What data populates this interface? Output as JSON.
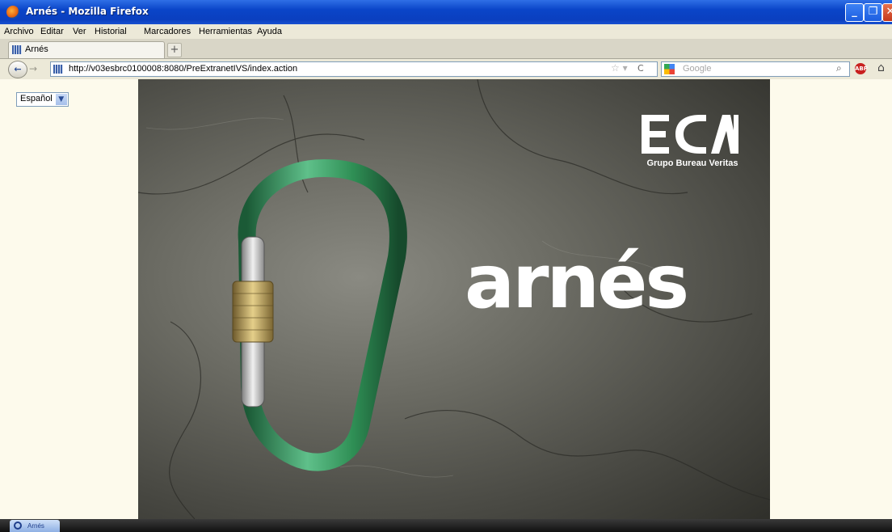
{
  "window": {
    "title": "Arnés - Mozilla Firefox",
    "controls": [
      "minimize",
      "maximize",
      "close"
    ]
  },
  "menu": {
    "items": [
      "Archivo",
      "Editar",
      "Ver",
      "Historial",
      "Marcadores",
      "Herramientas",
      "Ayuda"
    ]
  },
  "tabs": {
    "active_label": "Arnés",
    "new_tab_label": "+"
  },
  "navbar": {
    "url": "http://v03esbrc0100008:8080/PreExtranetIVS/index.action",
    "search_placeholder": "Google"
  },
  "page": {
    "language_select": {
      "selected": "Español"
    },
    "hero": {
      "brand_text": "arnés",
      "logo_text": "ECA",
      "logo_subtitle": "Grupo Bureau Veritas"
    }
  },
  "taskbar": {
    "button_label": "Arnés"
  },
  "colors": {
    "titlebar": "#0a45c8",
    "content_bg": "#fdfaec",
    "carabiner": "#2f8f55"
  },
  "icons": [
    "firefox-icon",
    "back-icon",
    "forward-icon",
    "star-icon",
    "reload-icon",
    "google-icon",
    "magnifier-icon",
    "adblock-icon",
    "home-icon"
  ]
}
